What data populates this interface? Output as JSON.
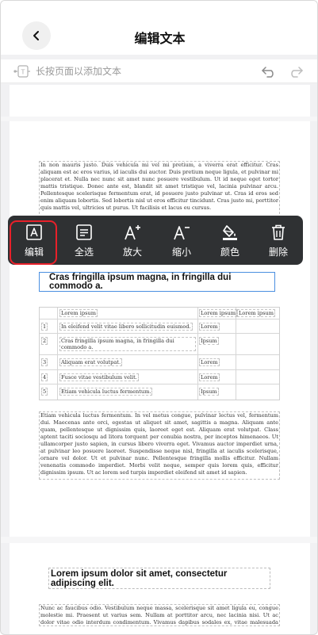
{
  "header": {
    "title": "编辑文本"
  },
  "hint": {
    "text": "长按页面以添加文本"
  },
  "toolbar": {
    "items": [
      {
        "label": "编辑",
        "icon": "edit-text-icon"
      },
      {
        "label": "全选",
        "icon": "select-all-icon"
      },
      {
        "label": "放大",
        "icon": "font-increase-icon"
      },
      {
        "label": "缩小",
        "icon": "font-decrease-icon"
      },
      {
        "label": "颜色",
        "icon": "color-fill-icon"
      },
      {
        "label": "删除",
        "icon": "trash-icon"
      }
    ]
  },
  "page1": {
    "para1": "In non mauris justo. Duis vehicula mi vel mi pretium, a viverra erat efficitur. Cras aliquam est ac eros varius, id iaculis dui auctor. Duis pretium neque ligula, et pulvinar mi placerat et. Nulla nec nunc sit amet nunc posuere vestibulum. Ut id neque eget tortor mattis tristique. Donec ante est, blandit sit amet tristique vel, lacinia pulvinar arcu. Pellentesque scelerisque fermentum erat, id posuere justo pulvinar ut. Cras id eros sed enim aliquam lobortis. Sed lobortis nisl ut eros efficitur tincidunt. Cras justo mi, porttitor quis mattis vel, ultricies ut purus. Ut facilisis et lacus eu cursus.",
    "heading": "Cras fringilla ipsum magna, in fringilla dui commodo a.",
    "table": {
      "header": [
        "Lorem ipsum",
        "Lorem ipsum",
        "Lorem ipsum"
      ],
      "rows": [
        {
          "num": "1",
          "text": "In eleifend velit vitae libero sollicitudin euismod.",
          "val": "Lorem"
        },
        {
          "num": "2",
          "text": "Cras fringilla ipsum magna, in fringilla dui commodo a.",
          "val": "Ipsum"
        },
        {
          "num": "3",
          "text": "Aliquam erat volutpat.",
          "val": "Lorem"
        },
        {
          "num": "4",
          "text": "Fusce vitae vestibulum velit.",
          "val": "Lorem"
        },
        {
          "num": "5",
          "text": "Etiam vehicula luctus fermentum.",
          "val": "Ipsum"
        }
      ]
    },
    "para2": "Etiam vehicula luctus fermentum. In vel metus congue, pulvinar lectus vel, fermentum dui. Maecenas ante orci, egestas ut aliquet sit amet, sagittis a magna. Aliquam ante quam, pellentesque ut dignissim quis, laoreet eget est. Aliquam erat volutpat. Class aptent taciti sociosqu ad litora torquent per conubia nostra, per inceptos himenaeos. Ut ullamcorper justo sapien, in cursus libero viverra eget. Vivamus auctor imperdiet urna, at pulvinar leo posuere laoreet. Suspendisse neque nisl, fringilla at iaculis scelerisque, ornare vel dolor. Ut et pulvinar nunc. Pellentesque fringilla mollis efficitur. Nullam venenatis commodo imperdiet. Morbi velit neque, semper quis lorem quis, efficitur dignissim ipsum. Ut ac lorem sed turpis imperdiet eleifend sit amet id sapien."
  },
  "page2": {
    "heading": "Lorem ipsum dolor sit amet, consectetur adipiscing elit.",
    "para": "Nunc ac faucibus odio. Vestibulum neque massa, scelerisque sit amet ligula eu, congue molestie mi. Praesent ut varius sem. Nullam at porttitor arcu, nec lacinia nisi. Ut ac dolor vitae odio interdum condimentum. Vivamus dapibus sodales ex, vitae malesuada ipsum"
  }
}
